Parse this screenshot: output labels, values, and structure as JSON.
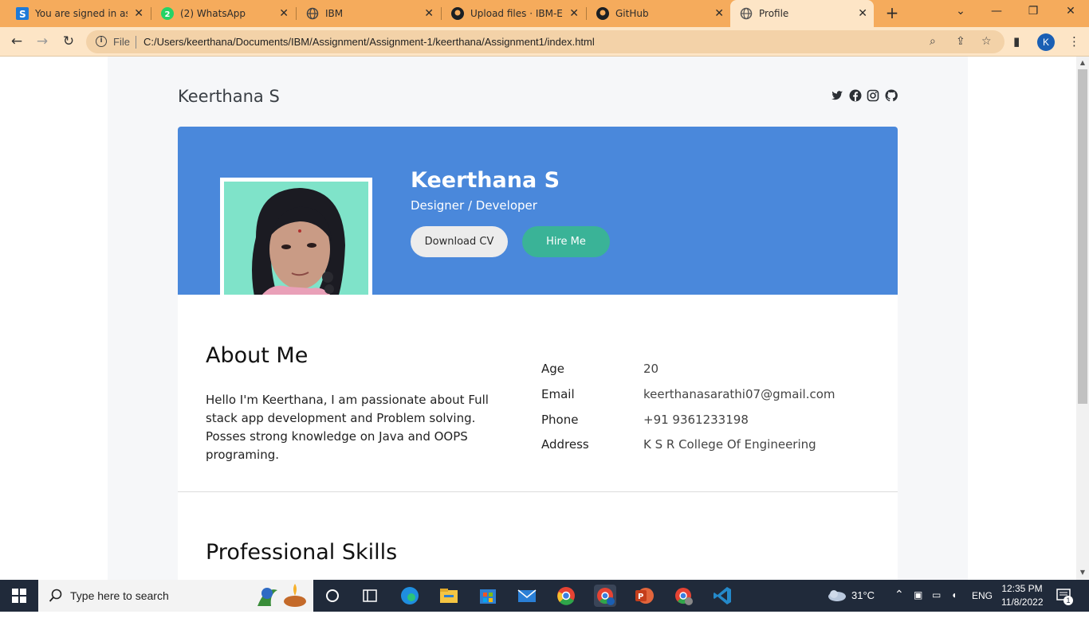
{
  "browser": {
    "tabs": [
      {
        "title": "You are signed in as co",
        "icon": "s-icon",
        "active": false
      },
      {
        "title": "(2) WhatsApp",
        "icon": "whatsapp-icon",
        "active": false
      },
      {
        "title": "IBM",
        "icon": "globe-icon",
        "active": false
      },
      {
        "title": "Upload files · IBM-EPB",
        "icon": "github-icon",
        "active": false
      },
      {
        "title": "GitHub",
        "icon": "github-icon",
        "active": false
      },
      {
        "title": "Profile",
        "icon": "globe-icon",
        "active": true
      }
    ],
    "address": {
      "scheme_label": "File",
      "url": "C:/Users/keerthana/Documents/IBM/Assignment/Assignment-1/keerthana/Assignment1/index.html"
    },
    "profile_initial": "K",
    "accent": "#f5ab5c"
  },
  "page": {
    "brand": "Keerthana S",
    "social": [
      "twitter-icon",
      "facebook-icon",
      "instagram-icon",
      "github-icon"
    ],
    "hero": {
      "name": "Keerthana S",
      "role": "Designer / Developer",
      "download_label": "Download CV",
      "hire_label": "Hire Me",
      "bg_color": "#4a88db",
      "hire_color": "#3ab397"
    },
    "about": {
      "heading": "About Me",
      "text": "Hello I'm Keerthana, I am passionate about Full stack app development and Problem solving. Posses strong knowledge on Java and OOPS programing."
    },
    "info": [
      {
        "label": "Age",
        "value": "20"
      },
      {
        "label": "Email",
        "value": "keerthanasarathi07@gmail.com"
      },
      {
        "label": "Phone",
        "value": "+91 9361233198"
      },
      {
        "label": "Address",
        "value": "K S R College Of Engineering"
      }
    ],
    "skills_heading": "Professional Skills"
  },
  "taskbar": {
    "search_placeholder": "Type here to search",
    "weather": "31°C",
    "language": "ENG",
    "time": "12:35 PM",
    "date": "11/8/2022",
    "notification_count": "1"
  }
}
